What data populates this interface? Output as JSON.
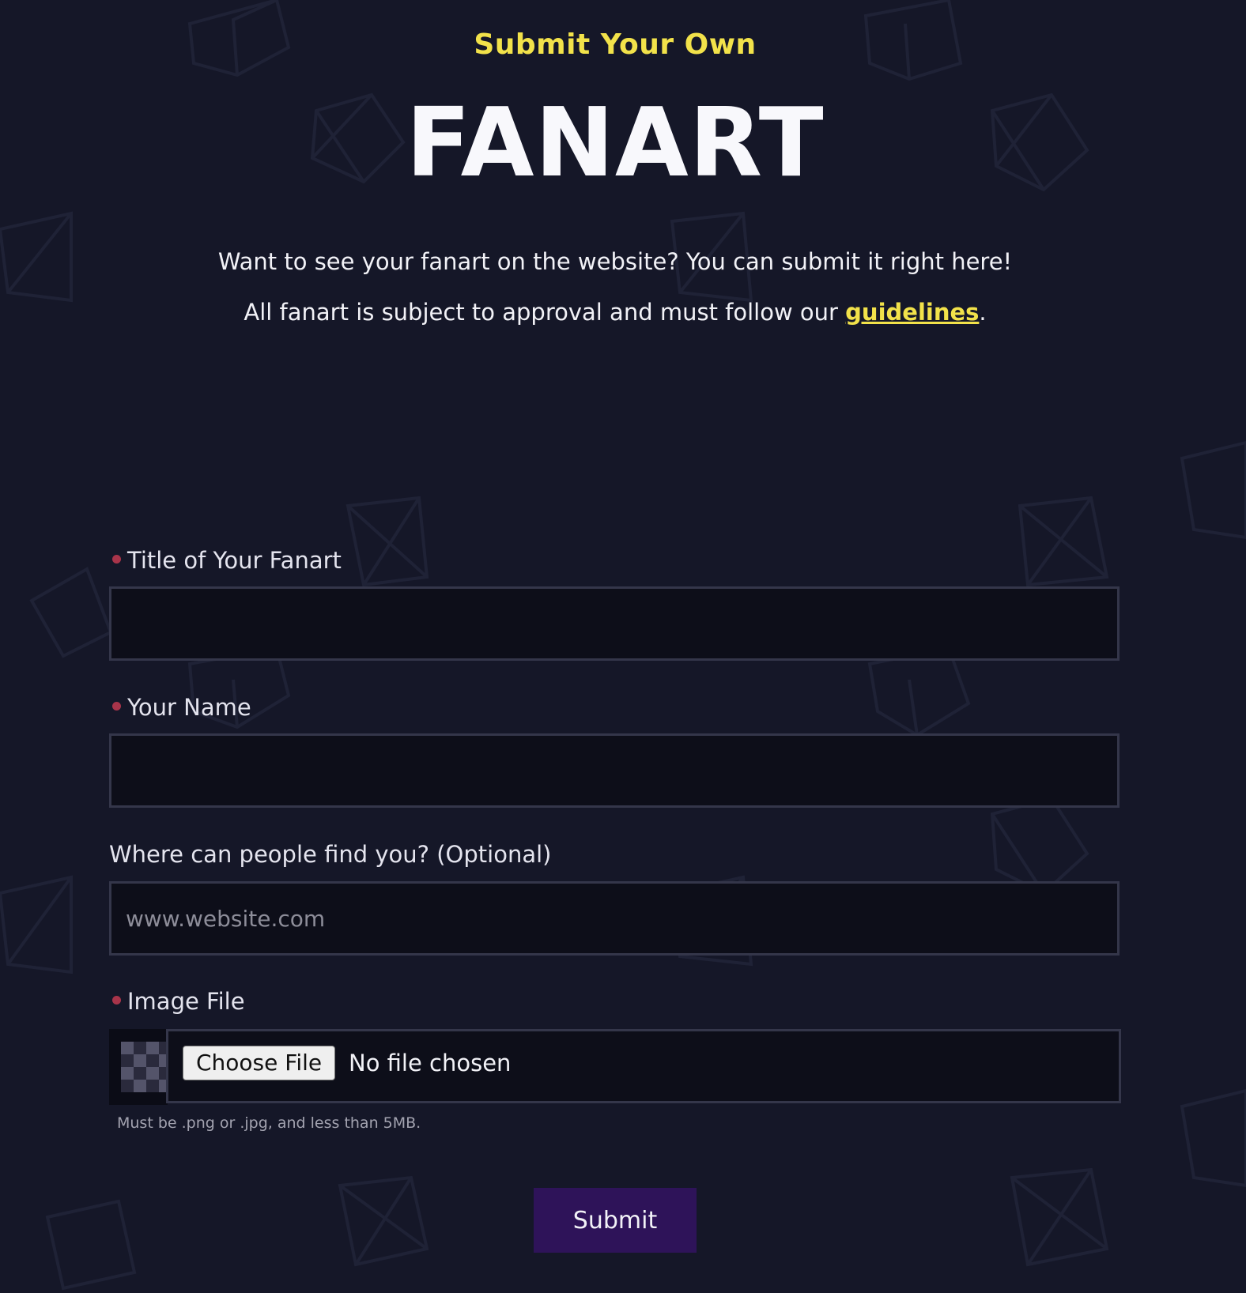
{
  "header": {
    "eyebrow": "Submit Your Own",
    "title": "FANART"
  },
  "intro": {
    "line1": "Want to see your fanart on the website? You can submit it right here!",
    "line2_prefix": "All fanart is subject to approval and must follow our ",
    "guidelines_link": "guidelines",
    "line2_suffix": "."
  },
  "form": {
    "title_field": {
      "label": "Title of Your Fanart",
      "value": "",
      "required": true
    },
    "name_field": {
      "label": "Your Name",
      "value": "",
      "required": true
    },
    "website_field": {
      "label": "Where can people find you? (Optional)",
      "placeholder": "www.website.com",
      "value": ""
    },
    "image_field": {
      "label": "Image File",
      "required": true,
      "button_label": "Choose File",
      "status": "No file chosen",
      "help": "Must be .png or .jpg, and less than 5MB."
    },
    "submit_label": "Submit"
  },
  "colors": {
    "background": "#151728",
    "accent_yellow": "#f2e24a",
    "required_dot": "#a8344a",
    "submit_bg": "#2e1359",
    "input_bg": "#0d0e19"
  }
}
